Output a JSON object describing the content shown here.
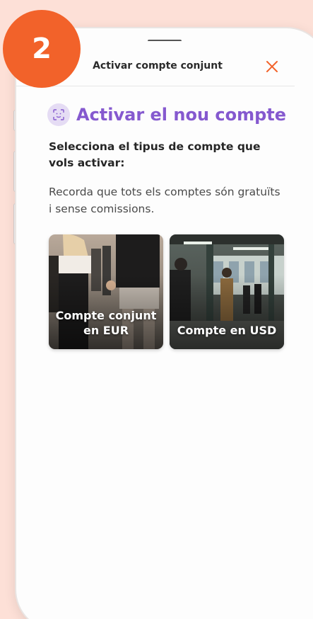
{
  "step_badge": {
    "number": "2",
    "color": "#f2622a"
  },
  "header": {
    "title": "Activar compte conjunt",
    "close_icon": "close-icon"
  },
  "main": {
    "title": "Activar el nou compte",
    "title_icon": "face-scan-icon",
    "subtitle": "Selecciona el tipus de compte que vols activar:",
    "note": "Recorda que tots els comptes són gratuïts i sense comissions."
  },
  "account_options": [
    {
      "label": "Compte conjunt en EUR",
      "image": "couple-holding-hands-photo"
    },
    {
      "label": "Compte en USD",
      "image": "subway-platform-photo"
    }
  ],
  "colors": {
    "accent_purple": "#8559cf",
    "accent_orange": "#f2622a",
    "background": "#fde0d7"
  }
}
